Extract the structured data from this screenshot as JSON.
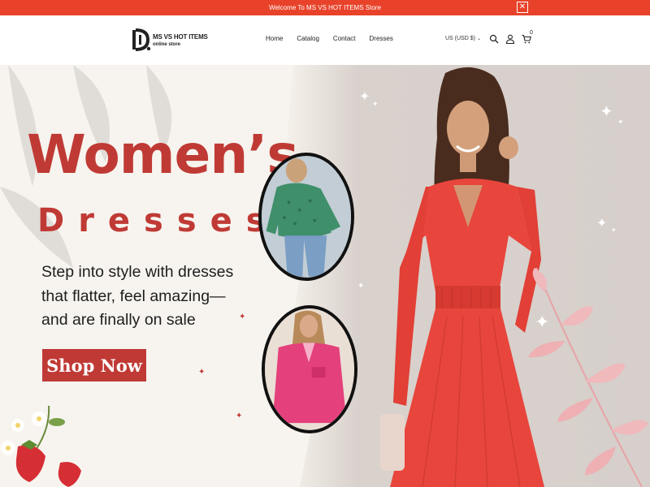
{
  "announcement": {
    "text": "Welcome To MS VS HOT ITEMS Store",
    "close_icon": "close-icon"
  },
  "header": {
    "logo": {
      "line1": "MS VS HOT ITEMS",
      "line2": "online store"
    },
    "nav": [
      {
        "label": "Home"
      },
      {
        "label": "Catalog"
      },
      {
        "label": "Contact"
      },
      {
        "label": "Dresses"
      }
    ],
    "currency": "US (USD $)",
    "cart_count": "0",
    "icons": [
      "search-icon",
      "account-icon",
      "cart-icon"
    ]
  },
  "hero": {
    "title_line1": "Women’s",
    "title_line2": "Dresses",
    "tagline": "Step into style with dresses that flatter, feel amazing—and are finally on sale",
    "cta": "Shop Now"
  },
  "colors": {
    "announcement_bg": "#e8432a",
    "accent": "#c03a35",
    "dress": "#e8453c"
  }
}
